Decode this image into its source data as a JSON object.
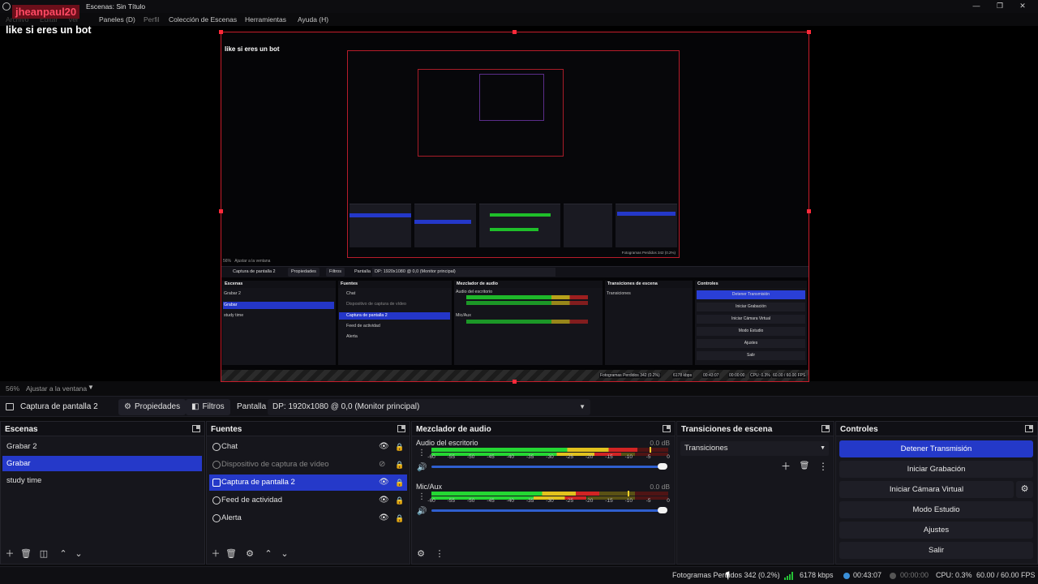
{
  "window": {
    "title": "Escenas: Sin Título",
    "minimize_icon": "minimize-icon",
    "maximize_icon": "restore-icon",
    "close_icon": "close-icon"
  },
  "menu": {
    "items": [
      "Archivo",
      "Editar",
      "Ver",
      "Paneles (D)",
      "Perfil",
      "Colección de Escenas",
      "Herramientas",
      "Ayuda (H)"
    ]
  },
  "overlay": {
    "streamer_name": "jheanpaul20",
    "text": "like si eres un bot"
  },
  "nested_preview": {
    "text": "like si eres un bot",
    "zoom": "56%",
    "fit_label": "Ajustar a la ventana",
    "source_name": "Captura de pantalla 2",
    "properties_label": "Propiedades",
    "filters_label": "Filtros",
    "display_label": "Pantalla",
    "display_value": "DP: 1920x1080 @ 0,0 (Monitor principal)",
    "scenes_title": "Escenas",
    "sources_title": "Fuentes",
    "mixer_title": "Mezclador de audio",
    "transitions_title": "Transiciones de escena",
    "controls_title": "Controles",
    "scenes": [
      "Grabar 2",
      "Grabar",
      "study time"
    ],
    "sources": [
      "Chat",
      "Dispositivo de captura de vídeo",
      "Captura de pantalla 2",
      "Feed de actividad",
      "Alerta"
    ],
    "channels": [
      "Audio del escritorio",
      "Mic/Aux"
    ],
    "transition": "Transiciones",
    "controls": [
      "Detener Transmisión",
      "Iniciar Grabación",
      "Iniciar Cámara Virtual",
      "Modo Estudio",
      "Ajustes",
      "Salir"
    ],
    "status": [
      "Fotogramas Perdidos 342 (0.2%)",
      "6178 kbps",
      "00:43:07",
      "00:00:00",
      "CPU: 0.3%",
      "60.00 / 60.00 FPS"
    ]
  },
  "preview_bar": {
    "zoom": "56%",
    "fit_label": "Ajustar a la ventana"
  },
  "source_toolbar": {
    "source_name": "Captura de pantalla 2",
    "properties_label": "Propiedades",
    "filters_label": "Filtros",
    "display_label": "Pantalla",
    "display_value": "DP: 1920x1080 @ 0,0 (Monitor principal)"
  },
  "scenes": {
    "title": "Escenas",
    "items": [
      {
        "label": "Grabar 2",
        "active": false
      },
      {
        "label": "Grabar",
        "active": true
      },
      {
        "label": "study time",
        "active": false
      }
    ]
  },
  "sources": {
    "title": "Fuentes",
    "items": [
      {
        "label": "Chat",
        "visible": true,
        "locked": false
      },
      {
        "label": "Dispositivo de captura de vídeo",
        "visible": false,
        "locked": false
      },
      {
        "label": "Captura de pantalla 2",
        "visible": true,
        "locked": false,
        "active": true
      },
      {
        "label": "Feed de actividad",
        "visible": true,
        "locked": false
      },
      {
        "label": "Alerta",
        "visible": true,
        "locked": false
      }
    ]
  },
  "mixer": {
    "title": "Mezclador de audio",
    "ticks": [
      "-60",
      "-55",
      "-50",
      "-45",
      "-40",
      "-35",
      "-30",
      "-25",
      "-20",
      "-15",
      "-10",
      "-5",
      "0"
    ],
    "channels": [
      {
        "name": "Audio del escritorio",
        "db": "0.0 dB",
        "level": 0.87,
        "peak": 0.92
      },
      {
        "name": "Mic/Aux",
        "db": "0.0 dB",
        "level": 0.71,
        "peak": 0.83
      }
    ]
  },
  "transitions": {
    "title": "Transiciones de escena",
    "selected": "Transiciones"
  },
  "controls": {
    "title": "Controles",
    "stop_stream": "Detener Transmisión",
    "start_recording": "Iniciar Grabación",
    "start_virtual_cam": "Iniciar Cámara Virtual",
    "studio_mode": "Modo Estudio",
    "settings": "Ajustes",
    "exit": "Salir"
  },
  "status": {
    "dropped_frames": "Fotogramas Perdidos 342 (0.2%)",
    "bitrate": "6178 kbps",
    "stream_time": "00:43:07",
    "record_time": "00:00:00",
    "cpu": "CPU: 0.3%",
    "fps": "60.00 / 60.00 FPS"
  },
  "colors": {
    "accent": "#2539c9",
    "selection_border": "#c61d2a",
    "meter_green": "#24d733",
    "meter_yellow": "#e2c21d",
    "meter_red": "#d22424"
  }
}
